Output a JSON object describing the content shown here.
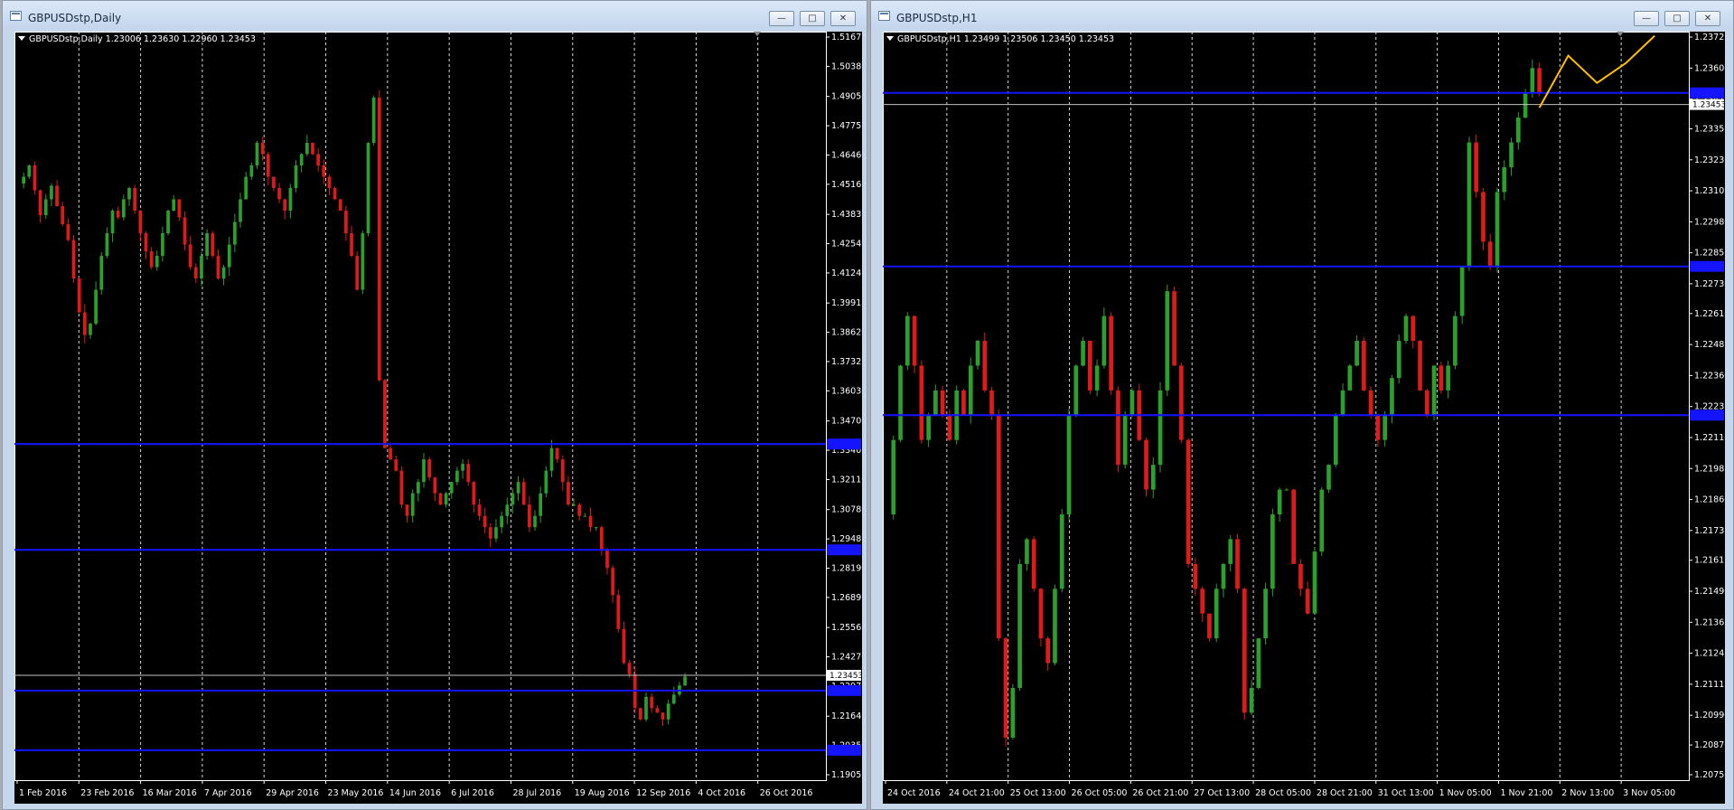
{
  "windows": [
    {
      "title": "GBPUSDstp,Daily",
      "ohlc": "GBPUSDstp,Daily  1.23006 1.23630 1.22960 1.23453",
      "price_labels": [
        "1.51675",
        "1.50380",
        "1.49050",
        "1.47755",
        "1.46460",
        "1.45165",
        "1.43835",
        "1.42540",
        "1.41245",
        "1.39915",
        "1.38620",
        "1.37325",
        "1.36030",
        "1.34700",
        "1.33405",
        "1.32110",
        "1.30780",
        "1.29485",
        "1.28190",
        "1.26895",
        "1.25565",
        "1.24270",
        "1.22975",
        "1.21645",
        "1.20350",
        "1.19055"
      ],
      "date_labels": [
        "1 Feb 2016",
        "23 Feb 2016",
        "16 Mar 2016",
        "7 Apr 2016",
        "29 Apr 2016",
        "23 May 2016",
        "14 Jun 2016",
        "6 Jul 2016",
        "28 Jul 2016",
        "19 Aug 2016",
        "12 Sep 2016",
        "4 Oct 2016",
        "26 Oct 2016"
      ],
      "current_price": "1.23453",
      "hlines": [
        "1.33680",
        "1.29000",
        "1.22780",
        "1.20140"
      ],
      "path": [
        1.452,
        1.455,
        1.46,
        1.449,
        1.438,
        1.445,
        1.451,
        1.442,
        1.434,
        1.427,
        1.41,
        1.395,
        1.385,
        1.39,
        1.405,
        1.42,
        1.43,
        1.44,
        1.437,
        1.445,
        1.45,
        1.44,
        1.43,
        1.422,
        1.415,
        1.42,
        1.43,
        1.44,
        1.445,
        1.437,
        1.425,
        1.415,
        1.41,
        1.42,
        1.43,
        1.42,
        1.41,
        1.415,
        1.425,
        1.435,
        1.445,
        1.455,
        1.46,
        1.47,
        1.465,
        1.455,
        1.45,
        1.445,
        1.44,
        1.45,
        1.46,
        1.465,
        1.47,
        1.465,
        1.46,
        1.455,
        1.45,
        1.445,
        1.44,
        1.43,
        1.42,
        1.405,
        1.43,
        1.47,
        1.49,
        1.365,
        1.335,
        1.33,
        1.325,
        1.31,
        1.305,
        1.315,
        1.32,
        1.33,
        1.322,
        1.315,
        1.31,
        1.315,
        1.32,
        1.325,
        1.328,
        1.32,
        1.31,
        1.305,
        1.3,
        1.295,
        1.3,
        1.305,
        1.31,
        1.315,
        1.32,
        1.31,
        1.3,
        1.305,
        1.315,
        1.325,
        1.335,
        1.33,
        1.32,
        1.31,
        1.31,
        1.305,
        1.305,
        1.3,
        1.3,
        1.29,
        1.282,
        1.27,
        1.255,
        1.24,
        1.235,
        1.22,
        1.215,
        1.225,
        1.22,
        1.218,
        1.215,
        1.222,
        1.226,
        1.23,
        1.234
      ],
      "colors": {
        "up": "#2ca02c",
        "down": "#e01a1a",
        "hline": "#1414ff",
        "grid": "#ffffff",
        "current_line": "#c0c0c0"
      }
    },
    {
      "title": "GBPUSDstp,H1",
      "ohlc": "GBPUSDstp,H1  1.23499 1.23506 1.23450 1.23453",
      "price_labels": [
        "1.23725",
        "1.23600",
        "1.23475",
        "1.23355",
        "1.23230",
        "1.23105",
        "1.22980",
        "1.22855",
        "1.22730",
        "1.22610",
        "1.22485",
        "1.22360",
        "1.22235",
        "1.22110",
        "1.21985",
        "1.21860",
        "1.21735",
        "1.21615",
        "1.21490",
        "1.21365",
        "1.21240",
        "1.21115",
        "1.20990",
        "1.20870",
        "1.20750"
      ],
      "date_labels": [
        "24 Oct 2016",
        "24 Oct 21:00",
        "25 Oct 13:00",
        "26 Oct 05:00",
        "26 Oct 21:00",
        "27 Oct 13:00",
        "28 Oct 05:00",
        "28 Oct 21:00",
        "31 Oct 13:00",
        "1 Nov 05:00",
        "1 Nov 21:00",
        "2 Nov 13:00",
        "3 Nov 05:00"
      ],
      "current_price": "1.23453",
      "hlines": [
        "1.23500",
        "1.22800",
        "1.22200"
      ],
      "path": [
        1.218,
        1.221,
        1.224,
        1.226,
        1.224,
        1.221,
        1.222,
        1.223,
        1.222,
        1.221,
        1.223,
        1.222,
        1.224,
        1.225,
        1.223,
        1.222,
        1.213,
        1.209,
        1.211,
        1.216,
        1.217,
        1.215,
        1.213,
        1.212,
        1.215,
        1.218,
        1.222,
        1.224,
        1.225,
        1.223,
        1.224,
        1.226,
        1.223,
        1.22,
        1.222,
        1.223,
        1.221,
        1.219,
        1.22,
        1.223,
        1.227,
        1.224,
        1.221,
        1.216,
        1.215,
        1.214,
        1.213,
        1.215,
        1.216,
        1.217,
        1.215,
        1.21,
        1.211,
        1.213,
        1.215,
        1.218,
        1.219,
        1.219,
        1.216,
        1.215,
        1.214,
        1.2165,
        1.219,
        1.22,
        1.222,
        1.223,
        1.224,
        1.225,
        1.223,
        1.222,
        1.221,
        1.222,
        1.2235,
        1.225,
        1.226,
        1.225,
        1.223,
        1.222,
        1.224,
        1.223,
        1.224,
        1.226,
        1.228,
        1.233,
        1.231,
        1.229,
        1.228,
        1.231,
        1.232,
        1.233,
        1.234,
        1.235,
        1.236,
        1.235
      ],
      "forecast": [
        1.2344,
        1.2365,
        1.2354,
        1.2362,
        1.2373
      ],
      "colors": {
        "up": "#2ca02c",
        "down": "#e01a1a",
        "hline": "#1414ff",
        "grid": "#ffffff",
        "forecast": "#ffc000",
        "current_line": "#c0c0c0"
      }
    }
  ],
  "window_controls": [
    "minimize",
    "maximize",
    "close"
  ]
}
